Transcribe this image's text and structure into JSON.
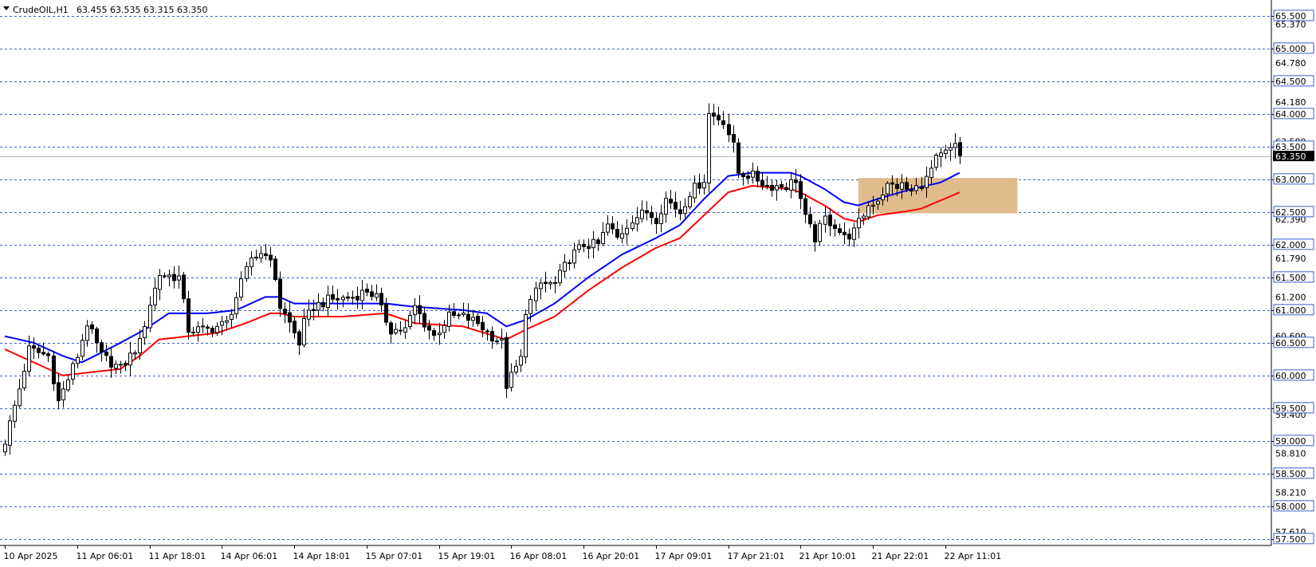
{
  "window": {
    "title": "CrudeOIL,H1",
    "ohlc": "63.455 63.535 63.315 63.350"
  },
  "colors": {
    "background": "#ffffff",
    "grid_line": "#3a5fcd",
    "candle_up_body": "#ffffff",
    "candle_down_body": "#000000",
    "candle_outline": "#000000",
    "ma_fast": "#0000ff",
    "ma_slow": "#ff0000",
    "zone_fill": "#deb887",
    "price_marker_bg": "#000000",
    "price_marker_text": "#ffffff"
  },
  "chart_data": {
    "type": "candlestick",
    "symbol": "CrudeOIL",
    "timeframe": "H1",
    "ylim": [
      57.4,
      65.62
    ],
    "y_gridlines": [
      65.5,
      65.0,
      64.5,
      64.0,
      63.5,
      63.0,
      62.5,
      62.0,
      61.5,
      61.0,
      60.5,
      60.0,
      59.5,
      59.0,
      58.5,
      58.0,
      57.5
    ],
    "y_labels_boxed": [
      "65.500",
      "65.000",
      "64.500",
      "64.000",
      "63.500",
      "63.000",
      "62.500",
      "62.000",
      "61.500",
      "61.000",
      "60.500",
      "60.000",
      "59.500",
      "59.000",
      "58.500",
      "58.000",
      "57.500"
    ],
    "y_labels_plain": [
      {
        "label": "65.370",
        "value": 65.37
      },
      {
        "label": "64.780",
        "value": 64.78
      },
      {
        "label": "64.180",
        "value": 64.18
      },
      {
        "label": "63.580",
        "value": 63.58
      },
      {
        "label": "62.390",
        "value": 62.39
      },
      {
        "label": "61.790",
        "value": 61.79
      },
      {
        "label": "61.200",
        "value": 61.2
      },
      {
        "label": "60.600",
        "value": 60.6
      },
      {
        "label": "59.400",
        "value": 59.4
      },
      {
        "label": "58.810",
        "value": 58.81
      },
      {
        "label": "58.210",
        "value": 58.21
      },
      {
        "label": "57.610",
        "value": 57.61
      }
    ],
    "x_labels": [
      {
        "label": "10 Apr 2025",
        "index": 0
      },
      {
        "label": "11 Apr 06:01",
        "index": 15
      },
      {
        "label": "11 Apr 18:01",
        "index": 30
      },
      {
        "label": "14 Apr 06:01",
        "index": 45
      },
      {
        "label": "14 Apr 18:01",
        "index": 60
      },
      {
        "label": "15 Apr 07:01",
        "index": 75
      },
      {
        "label": "15 Apr 19:01",
        "index": 90
      },
      {
        "label": "16 Apr 08:01",
        "index": 105
      },
      {
        "label": "16 Apr 20:01",
        "index": 120
      },
      {
        "label": "17 Apr 09:01",
        "index": 135
      },
      {
        "label": "17 Apr 21:01",
        "index": 150
      },
      {
        "label": "21 Apr 10:01",
        "index": 165
      },
      {
        "label": "21 Apr 22:01",
        "index": 180
      },
      {
        "label": "22 Apr 11:01",
        "index": 195
      }
    ],
    "close_anchors": [
      [
        0,
        59.0
      ],
      [
        3,
        59.8
      ],
      [
        5,
        60.4
      ],
      [
        9,
        60.3
      ],
      [
        11,
        59.6
      ],
      [
        15,
        60.3
      ],
      [
        17,
        60.8
      ],
      [
        20,
        60.3
      ],
      [
        24,
        60.1
      ],
      [
        28,
        60.5
      ],
      [
        30,
        61.1
      ],
      [
        32,
        61.55
      ],
      [
        36,
        61.5
      ],
      [
        38,
        60.7
      ],
      [
        42,
        60.7
      ],
      [
        46,
        60.8
      ],
      [
        48,
        61.2
      ],
      [
        51,
        61.8
      ],
      [
        54,
        61.9
      ],
      [
        56,
        61.5
      ],
      [
        57,
        61.05
      ],
      [
        59,
        60.8
      ],
      [
        61,
        60.5
      ],
      [
        62,
        60.8
      ],
      [
        64,
        61.05
      ],
      [
        67,
        61.15
      ],
      [
        72,
        61.2
      ],
      [
        75,
        61.3
      ],
      [
        77,
        61.2
      ],
      [
        78,
        61.0
      ],
      [
        80,
        60.7
      ],
      [
        83,
        60.7
      ],
      [
        85,
        61.05
      ],
      [
        87,
        60.8
      ],
      [
        89,
        60.6
      ],
      [
        92,
        60.9
      ],
      [
        95,
        60.9
      ],
      [
        98,
        60.8
      ],
      [
        101,
        60.6
      ],
      [
        103,
        60.5
      ],
      [
        104,
        59.85
      ],
      [
        107,
        60.25
      ],
      [
        108,
        61.0
      ],
      [
        111,
        61.4
      ],
      [
        114,
        61.4
      ],
      [
        117,
        61.8
      ],
      [
        120,
        62.0
      ],
      [
        123,
        62.0
      ],
      [
        125,
        62.3
      ],
      [
        127,
        62.1
      ],
      [
        130,
        62.4
      ],
      [
        133,
        62.5
      ],
      [
        135,
        62.4
      ],
      [
        137,
        62.7
      ],
      [
        140,
        62.5
      ],
      [
        142,
        62.8
      ],
      [
        145,
        63.0
      ],
      [
        146,
        64.0
      ],
      [
        149,
        63.9
      ],
      [
        151,
        63.5
      ],
      [
        152,
        63.1
      ],
      [
        155,
        63.05
      ],
      [
        158,
        62.9
      ],
      [
        162,
        62.9
      ],
      [
        164,
        63.0
      ],
      [
        166,
        62.4
      ],
      [
        168,
        62.1
      ],
      [
        170,
        62.4
      ],
      [
        172,
        62.3
      ],
      [
        174,
        62.1
      ],
      [
        176,
        62.2
      ],
      [
        179,
        62.6
      ],
      [
        181,
        62.7
      ],
      [
        183,
        62.9
      ],
      [
        186,
        62.9
      ],
      [
        188,
        62.8
      ],
      [
        191,
        63.0
      ],
      [
        193,
        63.3
      ],
      [
        195,
        63.4
      ],
      [
        197,
        63.5
      ],
      [
        198,
        63.35
      ]
    ],
    "ma_fast_anchors": [
      [
        0,
        60.6
      ],
      [
        6,
        60.5
      ],
      [
        12,
        60.3
      ],
      [
        16,
        60.2
      ],
      [
        24,
        60.5
      ],
      [
        29,
        60.7
      ],
      [
        34,
        60.95
      ],
      [
        42,
        60.95
      ],
      [
        48,
        61.0
      ],
      [
        54,
        61.2
      ],
      [
        57,
        61.2
      ],
      [
        60,
        61.1
      ],
      [
        70,
        61.1
      ],
      [
        79,
        61.1
      ],
      [
        85,
        61.05
      ],
      [
        95,
        61.0
      ],
      [
        100,
        60.95
      ],
      [
        104,
        60.75
      ],
      [
        108,
        60.85
      ],
      [
        114,
        61.1
      ],
      [
        121,
        61.5
      ],
      [
        128,
        61.85
      ],
      [
        135,
        62.1
      ],
      [
        140,
        62.3
      ],
      [
        145,
        62.7
      ],
      [
        150,
        63.05
      ],
      [
        155,
        63.1
      ],
      [
        163,
        63.1
      ],
      [
        165,
        63.05
      ],
      [
        170,
        62.85
      ],
      [
        174,
        62.65
      ],
      [
        177,
        62.6
      ],
      [
        181,
        62.7
      ],
      [
        188,
        62.85
      ],
      [
        194,
        62.95
      ],
      [
        198,
        63.1
      ]
    ],
    "ma_slow_anchors": [
      [
        0,
        60.4
      ],
      [
        6,
        60.2
      ],
      [
        12,
        60.0
      ],
      [
        18,
        60.05
      ],
      [
        24,
        60.1
      ],
      [
        28,
        60.3
      ],
      [
        32,
        60.55
      ],
      [
        38,
        60.6
      ],
      [
        44,
        60.65
      ],
      [
        50,
        60.8
      ],
      [
        55,
        60.95
      ],
      [
        57,
        60.95
      ],
      [
        60,
        60.9
      ],
      [
        70,
        60.9
      ],
      [
        79,
        60.95
      ],
      [
        85,
        60.8
      ],
      [
        95,
        60.75
      ],
      [
        104,
        60.55
      ],
      [
        108,
        60.7
      ],
      [
        114,
        60.9
      ],
      [
        121,
        61.3
      ],
      [
        128,
        61.65
      ],
      [
        135,
        61.95
      ],
      [
        140,
        62.1
      ],
      [
        145,
        62.45
      ],
      [
        150,
        62.8
      ],
      [
        155,
        62.9
      ],
      [
        163,
        62.85
      ],
      [
        165,
        62.8
      ],
      [
        170,
        62.6
      ],
      [
        174,
        62.4
      ],
      [
        177,
        62.35
      ],
      [
        181,
        62.45
      ],
      [
        186,
        62.5
      ],
      [
        190,
        62.55
      ],
      [
        198,
        62.8
      ]
    ],
    "candle_count": 199,
    "zone": {
      "start_index": 177,
      "end_index": 210,
      "low": 62.48,
      "high": 63.02
    },
    "current_price": 63.35,
    "current_price_label": "63.350",
    "series": [
      {
        "name": "",
        "kind": "moving-average",
        "color": "#0000ff"
      },
      {
        "name": "",
        "kind": "moving-average",
        "color": "#ff0000"
      }
    ]
  }
}
